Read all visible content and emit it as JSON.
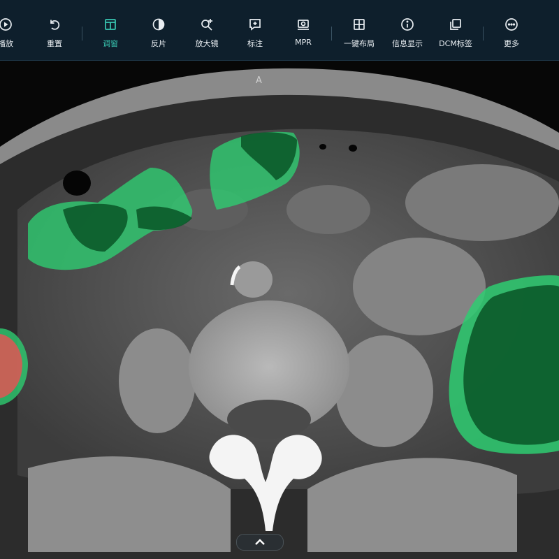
{
  "toolbar": {
    "items": [
      {
        "label": "播放",
        "icon": "play-icon"
      },
      {
        "label": "重置",
        "icon": "reset-icon"
      },
      {
        "label": "调窗",
        "icon": "window-level-icon",
        "active": true
      },
      {
        "label": "反片",
        "icon": "invert-icon"
      },
      {
        "label": "放大镜",
        "icon": "magnifier-icon"
      },
      {
        "label": "标注",
        "icon": "annotate-icon"
      },
      {
        "label": "MPR",
        "icon": "mpr-icon"
      },
      {
        "label": "一键布局",
        "icon": "layout-icon"
      },
      {
        "label": "信息显示",
        "icon": "info-icon"
      },
      {
        "label": "DCM标签",
        "icon": "dcm-tag-icon"
      },
      {
        "label": "更多",
        "icon": "more-icon"
      }
    ],
    "accent_color": "#39c7b2",
    "background_color": "#0e1f2c"
  },
  "viewport": {
    "orientation_label": "A",
    "segmentation_colors": {
      "green": "#2ecc71",
      "dark_green": "#0b5a2a",
      "red": "#e05555"
    }
  },
  "collapse_button": {
    "icon": "chevron-up-icon"
  }
}
